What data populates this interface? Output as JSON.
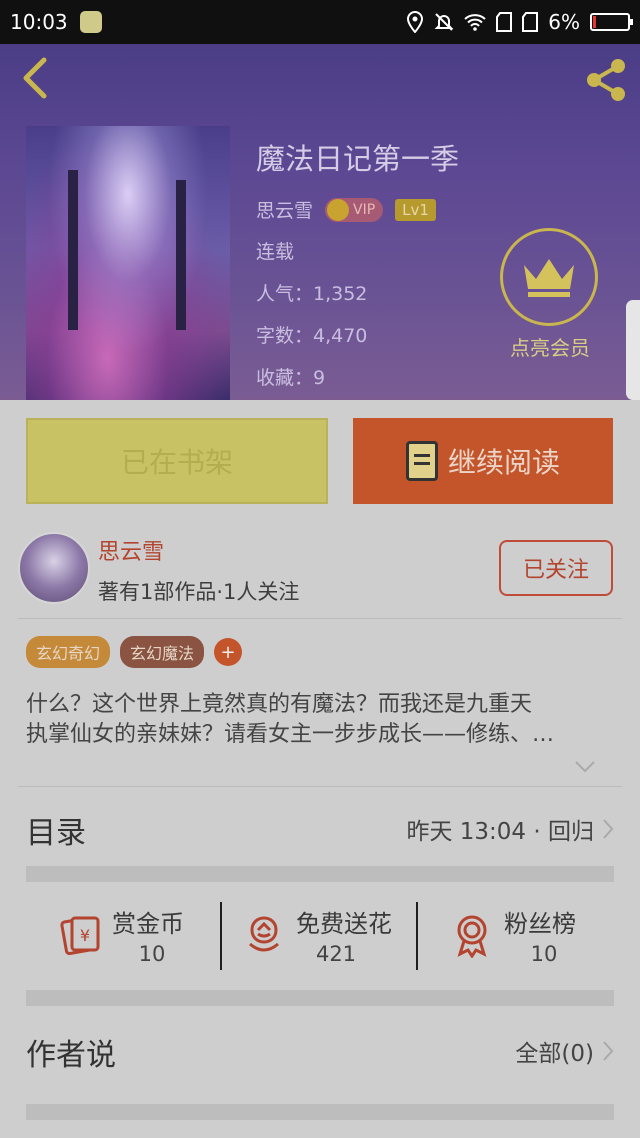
{
  "status_bar": {
    "time": "10:03",
    "battery": "6%",
    "battery_level": 0.06
  },
  "book": {
    "title": "魔法日记第一季",
    "author": "思云雪",
    "vip_label": "VIP",
    "level": "Lv1",
    "status": "连载",
    "popularity": "人气：1,352",
    "word_count": "字数：4,470",
    "favorites": "收藏：9"
  },
  "member": {
    "label": "点亮会员"
  },
  "actions": {
    "shelf_label": "已在书架",
    "read_label": "继续阅读"
  },
  "author_card": {
    "name": "思云雪",
    "stats": "著有1部作品·1人关注",
    "follow_label": "已关注"
  },
  "tags": [
    "玄幻奇幻",
    "玄幻魔法"
  ],
  "tag_add": "+",
  "synopsis": {
    "line1": "什么？这个世界上竟然真的有魔法？而我还是九重天",
    "line2": "执掌仙女的亲妹妹？请看女主一步步成长——修练、…"
  },
  "catalog": {
    "label": "目录",
    "update": "昨天 13:04 · 回归"
  },
  "stats": [
    {
      "label": "赏金币",
      "value": "10",
      "icon": "red-envelope-icon"
    },
    {
      "label": "免费送花",
      "value": "421",
      "icon": "flower-icon"
    },
    {
      "label": "粉丝榜",
      "value": "10",
      "icon": "medal-icon"
    }
  ],
  "author_notes": {
    "label": "作者说",
    "count": "全部(0)"
  },
  "colors": {
    "accent": "#c4552b",
    "shelf": "#c9c264",
    "header": "#5c4893",
    "gold": "#c9b64e"
  }
}
